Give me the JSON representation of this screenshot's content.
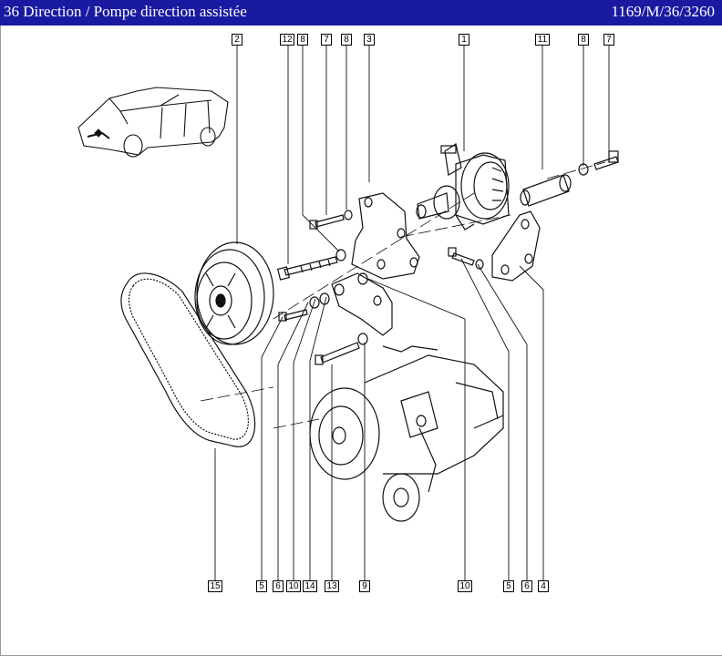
{
  "header": {
    "title": "36 Direction / Pompe direction assistée",
    "reference": "1169/M/36/3260"
  },
  "callouts": {
    "top": [
      "2",
      "12",
      "8",
      "7",
      "8",
      "3",
      "1",
      "11",
      "8",
      "7"
    ],
    "bottom": [
      "15",
      "5",
      "6",
      "10",
      "14",
      "13",
      "9",
      "10",
      "5",
      "6",
      "4"
    ]
  },
  "colors": {
    "title_bar": "#1a1aa0",
    "title_text": "#ffffff"
  }
}
